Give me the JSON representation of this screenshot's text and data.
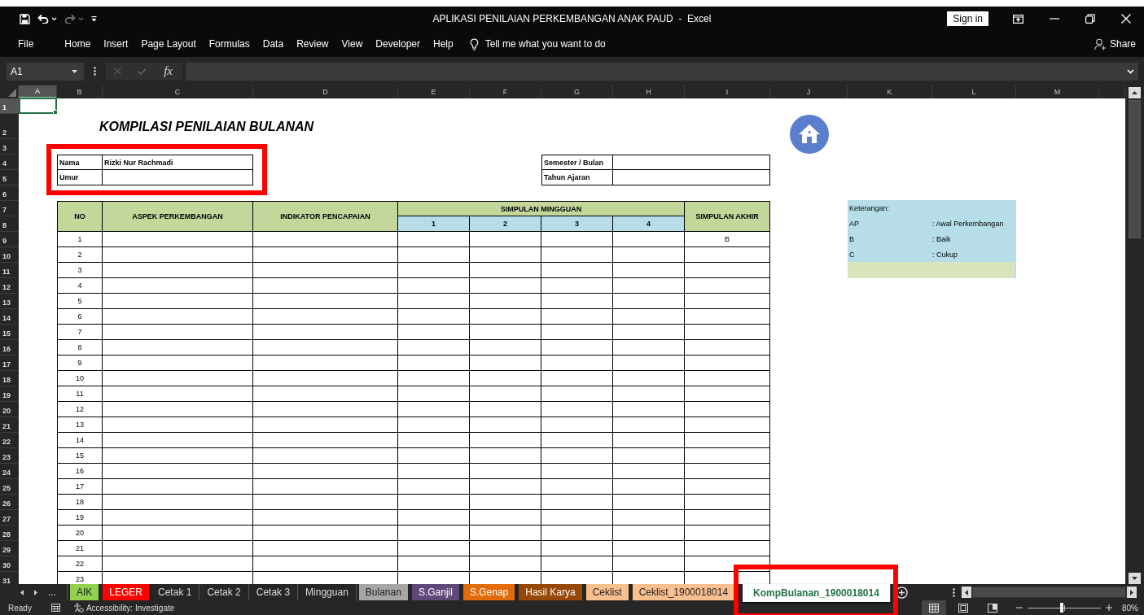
{
  "window": {
    "title": "APLIKASI PENILAIAN PERKEMBANGAN ANAK PAUD  -  Excel",
    "sign_in": "Sign in"
  },
  "quick_access": [
    {
      "kind": "save",
      "disabled": false
    },
    {
      "kind": "undo",
      "disabled": false
    },
    {
      "kind": "redo",
      "disabled": true
    },
    {
      "kind": "customize",
      "disabled": false
    }
  ],
  "ribbon_tabs": [
    "File",
    "Home",
    "Insert",
    "Page Layout",
    "Formulas",
    "Data",
    "Review",
    "View",
    "Developer",
    "Help"
  ],
  "tell_me": "Tell me what you want to do",
  "share": "Share",
  "formula_bar": {
    "name_box": "A1",
    "function_button": "fx"
  },
  "column_headers": [
    {
      "label": "A",
      "selected": true
    },
    {
      "label": "B",
      "selected": false
    },
    {
      "label": "C",
      "selected": false
    },
    {
      "label": "D",
      "selected": false
    },
    {
      "label": "E",
      "selected": false
    },
    {
      "label": "F",
      "selected": false
    },
    {
      "label": "G",
      "selected": false
    },
    {
      "label": "H",
      "selected": false
    },
    {
      "label": "I",
      "selected": false
    },
    {
      "label": "J",
      "selected": false
    },
    {
      "label": "K",
      "selected": false
    },
    {
      "label": "L",
      "selected": false
    },
    {
      "label": "M",
      "selected": false
    }
  ],
  "row_numbers": [
    {
      "label": "1",
      "selected": true
    },
    {
      "label": "2",
      "selected": false
    },
    {
      "label": "3",
      "selected": false
    },
    {
      "label": "4",
      "selected": false
    },
    {
      "label": "5",
      "selected": false
    },
    {
      "label": "6",
      "selected": false
    },
    {
      "label": "7",
      "selected": false
    },
    {
      "label": "8",
      "selected": false
    },
    {
      "label": "9",
      "selected": false
    },
    {
      "label": "10",
      "selected": false
    },
    {
      "label": "11",
      "selected": false
    },
    {
      "label": "12",
      "selected": false
    },
    {
      "label": "13",
      "selected": false
    },
    {
      "label": "14",
      "selected": false
    },
    {
      "label": "15",
      "selected": false
    },
    {
      "label": "16",
      "selected": false
    },
    {
      "label": "17",
      "selected": false
    },
    {
      "label": "18",
      "selected": false
    },
    {
      "label": "19",
      "selected": false
    },
    {
      "label": "20",
      "selected": false
    },
    {
      "label": "21",
      "selected": false
    },
    {
      "label": "22",
      "selected": false
    },
    {
      "label": "23",
      "selected": false
    },
    {
      "label": "24",
      "selected": false
    },
    {
      "label": "25",
      "selected": false
    },
    {
      "label": "26",
      "selected": false
    },
    {
      "label": "27",
      "selected": false
    },
    {
      "label": "28",
      "selected": false
    },
    {
      "label": "29",
      "selected": false
    },
    {
      "label": "30",
      "selected": false
    },
    {
      "label": "31",
      "selected": false
    }
  ],
  "sheet": {
    "title": "KOMPILASI PENILAIAN BULANAN",
    "student_fields_highlighted": true,
    "student_fields": [
      {
        "label": "Nama",
        "value": "Rizki Nur Rachmadi"
      },
      {
        "label": "Umur"
      }
    ],
    "period_fields": [
      {
        "label": "Semester / Bulan"
      },
      {
        "label": "Tahun Ajaran"
      }
    ],
    "table": {
      "columns": [
        "NO",
        "ASPEK PERKEMBANGAN",
        "INDIKATOR PENCAPAIAN"
      ],
      "weekly_group": "SIMPULAN MINGGUAN",
      "weeks": [
        "1",
        "2",
        "3",
        "4"
      ],
      "final_column": "SIMPULAN AKHIR",
      "rows": [
        {
          "no": "1",
          "final": "B"
        },
        {
          "no": "2"
        },
        {
          "no": "3"
        },
        {
          "no": "4"
        },
        {
          "no": "5"
        },
        {
          "no": "6"
        },
        {
          "no": "7"
        },
        {
          "no": "8"
        },
        {
          "no": "9"
        },
        {
          "no": "10"
        },
        {
          "no": "11"
        },
        {
          "no": "12"
        },
        {
          "no": "13"
        },
        {
          "no": "14"
        },
        {
          "no": "15"
        },
        {
          "no": "16"
        },
        {
          "no": "17"
        },
        {
          "no": "18"
        },
        {
          "no": "19"
        },
        {
          "no": "20"
        },
        {
          "no": "21"
        },
        {
          "no": "22"
        },
        {
          "no": "23"
        }
      ]
    },
    "legend": {
      "title": "Keterangan:",
      "items": [
        {
          "code": "AP",
          "meaning": ": Awal Perkembangan"
        },
        {
          "code": "B",
          "meaning": ": Baik"
        },
        {
          "code": "C",
          "meaning": ": Cukup"
        }
      ]
    }
  },
  "sheet_tabs_overflow": "...",
  "sheet_tabs": [
    {
      "label": "AIK",
      "color": "#92d050",
      "selected": false,
      "highlighted": false
    },
    {
      "label": "LEGER",
      "color": "#ff0000",
      "selected": false,
      "highlighted": false
    },
    {
      "label": "Cetak 1",
      "selected": false,
      "highlighted": false
    },
    {
      "label": "Cetak 2",
      "selected": false,
      "highlighted": false
    },
    {
      "label": "Cetak 3",
      "selected": false,
      "highlighted": false
    },
    {
      "label": "Mingguan",
      "selected": false,
      "highlighted": false
    },
    {
      "label": "Bulanan",
      "color": "#a6a6a6",
      "selected": false,
      "highlighted": false
    },
    {
      "label": "S.Ganjil",
      "color": "#60497a",
      "selected": false,
      "highlighted": false
    },
    {
      "label": "S.Genap",
      "color": "#e26b0a",
      "selected": false,
      "highlighted": false
    },
    {
      "label": "Hasil Karya",
      "color": "#974706",
      "selected": false,
      "highlighted": false
    },
    {
      "label": "Ceklist",
      "color": "#fabf8f",
      "selected": false,
      "highlighted": false
    },
    {
      "label": "Ceklist_1900018014",
      "color": "#fabf8f",
      "selected": false,
      "highlighted": false
    },
    {
      "label": "KompBulanan_1900018014",
      "selected": true,
      "highlighted": true
    }
  ],
  "status_bar": {
    "ready": "Ready",
    "accessibility": "Accessibility: Investigate",
    "views": [
      {
        "kind": "normal",
        "selected": true
      },
      {
        "kind": "page-layout",
        "selected": false
      },
      {
        "kind": "page-break",
        "selected": false
      }
    ],
    "zoom_slider": {
      "level": 0.47
    },
    "zoom": "80%"
  }
}
